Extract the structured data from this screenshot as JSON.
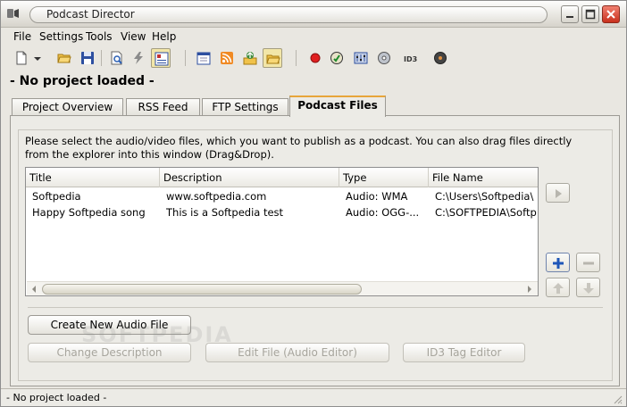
{
  "window": {
    "title": "Podcast Director"
  },
  "menu": {
    "items": [
      "File",
      "Settings",
      "Tools",
      "View",
      "Help"
    ]
  },
  "toolbar": {
    "icons": [
      "new-document-icon",
      "dropdown-arrow-icon",
      "open-folder-icon",
      "save-disk-icon",
      "preview-icon",
      "lightning-icon",
      "page-settings-icon",
      "calendar-icon",
      "rss-icon",
      "upload-icon",
      "folder-icon",
      "record-icon",
      "audio-edit-icon",
      "mixer-icon",
      "cd-icon",
      "id3-icon",
      "burn-icon"
    ]
  },
  "project": {
    "title": "- No project loaded -"
  },
  "tabs": [
    {
      "label": "Project Overview",
      "active": false
    },
    {
      "label": "RSS Feed",
      "active": false
    },
    {
      "label": "FTP Settings",
      "active": false
    },
    {
      "label": "Podcast Files",
      "active": true
    }
  ],
  "podcast_files": {
    "instructions": "Please select the audio/video files, which you want to publish as a podcast. You can also drag files directly from the explorer into this window (Drag&Drop).",
    "columns": [
      "Title",
      "Description",
      "Type",
      "File Name"
    ],
    "rows": [
      {
        "title": "Softpedia",
        "description": "www.softpedia.com",
        "type": "Audio: WMA",
        "file_name": "C:\\Users\\Softpedia\\"
      },
      {
        "title": "Happy Softpedia song",
        "description": "This is a Softpedia test",
        "type": "Audio: OGG-...",
        "file_name": "C:\\SOFTPEDIA\\Softp"
      }
    ],
    "buttons": {
      "create_new_audio": "Create New Audio File",
      "change_description": "Change Description",
      "edit_file": "Edit File (Audio Editor)",
      "id3_tag_editor": "ID3 Tag Editor"
    },
    "watermark": "SOFTPEDIA"
  },
  "status": {
    "text": "- No project loaded -"
  }
}
